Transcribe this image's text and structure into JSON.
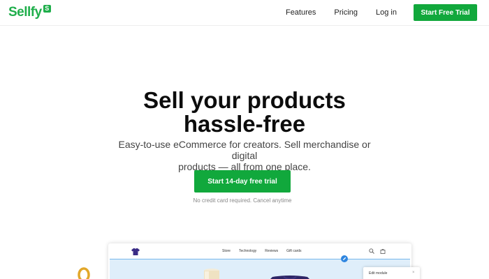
{
  "brand": {
    "name": "Sellfy",
    "badge": "S",
    "color": "#1fae4b"
  },
  "nav": {
    "links": [
      "Features",
      "Pricing",
      "Log in"
    ],
    "cta_label": "Start Free Trial"
  },
  "hero": {
    "title_line1": "Sell your products",
    "title_line2": "hassle-free",
    "subtitle_line1": "Easy-to-use eCommerce for creators. Sell merchandise or digital",
    "subtitle_line2": "products — all from one place.",
    "cta_label": "Start 14-day free trial",
    "note": "No credit card required. Cancel anytime"
  },
  "preview": {
    "logo_icon": "tshirt-icon",
    "links": [
      "Store",
      "Technology",
      "Reviews",
      "Gift cards"
    ],
    "search_icon": "search-icon",
    "cart_icon": "cart-icon",
    "edit_panel_title": "Edit module",
    "edit_panel_close": "×"
  },
  "colors": {
    "accent": "#11a83c",
    "banner": "#dfeefa"
  }
}
